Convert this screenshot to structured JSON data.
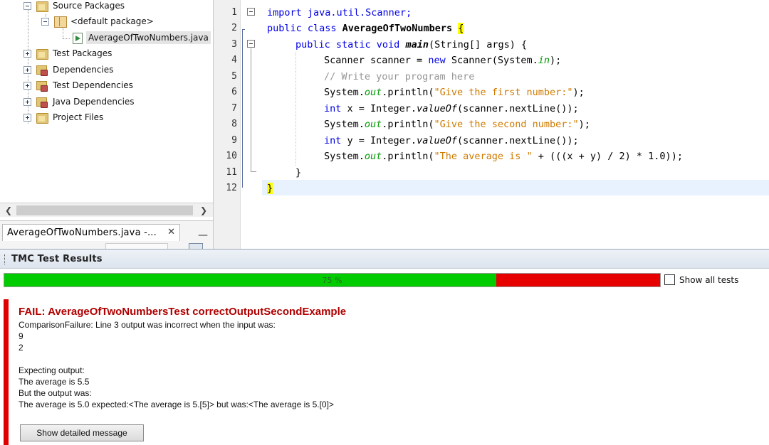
{
  "project_tree": {
    "nodes": [
      {
        "label": "Source Packages"
      },
      {
        "label": "<default package>"
      },
      {
        "label": "AverageOfTwoNumbers.java"
      },
      {
        "label": "Test Packages"
      },
      {
        "label": "Dependencies"
      },
      {
        "label": "Test Dependencies"
      },
      {
        "label": "Java Dependencies"
      },
      {
        "label": "Project Files"
      }
    ]
  },
  "navigator": {
    "tab_label": "AverageOfTwoNumbers.java -...",
    "close_glyph": "✕",
    "minimize_glyph": "—"
  },
  "editor": {
    "line_numbers": [
      "1",
      "2",
      "3",
      "4",
      "5",
      "6",
      "7",
      "8",
      "9",
      "10",
      "11",
      "12"
    ],
    "code": {
      "l1": "import java.util.Scanner;",
      "l2_kw": "public class ",
      "l2_name": "AverageOfTwoNumbers",
      "l2_brace": "{",
      "l3_kw": "public static void ",
      "l3_name": "main",
      "l3_rest": "(String[] args) {",
      "l4_a": "Scanner scanner = ",
      "l4_kw": "new",
      "l4_b": " Scanner(System.",
      "l4_fld": "in",
      "l4_c": ");",
      "l5": "// Write your program here",
      "l6_a": "System.",
      "l6_fld": "out",
      "l6_b": ".println(",
      "l6_str": "\"Give the first number:\"",
      "l6_c": ");",
      "l7_kw": "int",
      "l7_a": " x = Integer.",
      "l7_stat": "valueOf",
      "l7_b": "(scanner.nextLine());",
      "l8_a": "System.",
      "l8_fld": "out",
      "l8_b": ".println(",
      "l8_str": "\"Give the second number:\"",
      "l8_c": ");",
      "l9_kw": "int",
      "l9_a": " y = Integer.",
      "l9_stat": "valueOf",
      "l9_b": "(scanner.nextLine());",
      "l10_a": "System.",
      "l10_fld": "out",
      "l10_b": ".println(",
      "l10_str": "\"The average is \"",
      "l10_c": " + (((x + y) / 2) * 1.0));",
      "l11": "}",
      "l12": "}"
    }
  },
  "tmc": {
    "title": "TMC Test Results",
    "progress_percent": 75,
    "progress_label": "75 %",
    "show_all_tests": "Show all tests",
    "show_all_checked": false,
    "result": {
      "heading": "FAIL: AverageOfTwoNumbersTest correctOutputSecondExample",
      "lines": [
        "ComparisonFailure: Line 3 output was incorrect when the input was:",
        "9",
        "2",
        "",
        "Expecting output:",
        "The average is 5.5",
        "But the output was:",
        "The average is 5.0 expected:<The average is 5.[5]> but was:<The average is 5.[0]>"
      ],
      "button": "Show detailed message"
    }
  },
  "colors": {
    "pass": "#00cc00",
    "fail": "#e60000",
    "fail_text": "#b00000",
    "keyword": "#0000e6",
    "string": "#ce7b00",
    "field": "#009900",
    "comment": "#969696"
  }
}
